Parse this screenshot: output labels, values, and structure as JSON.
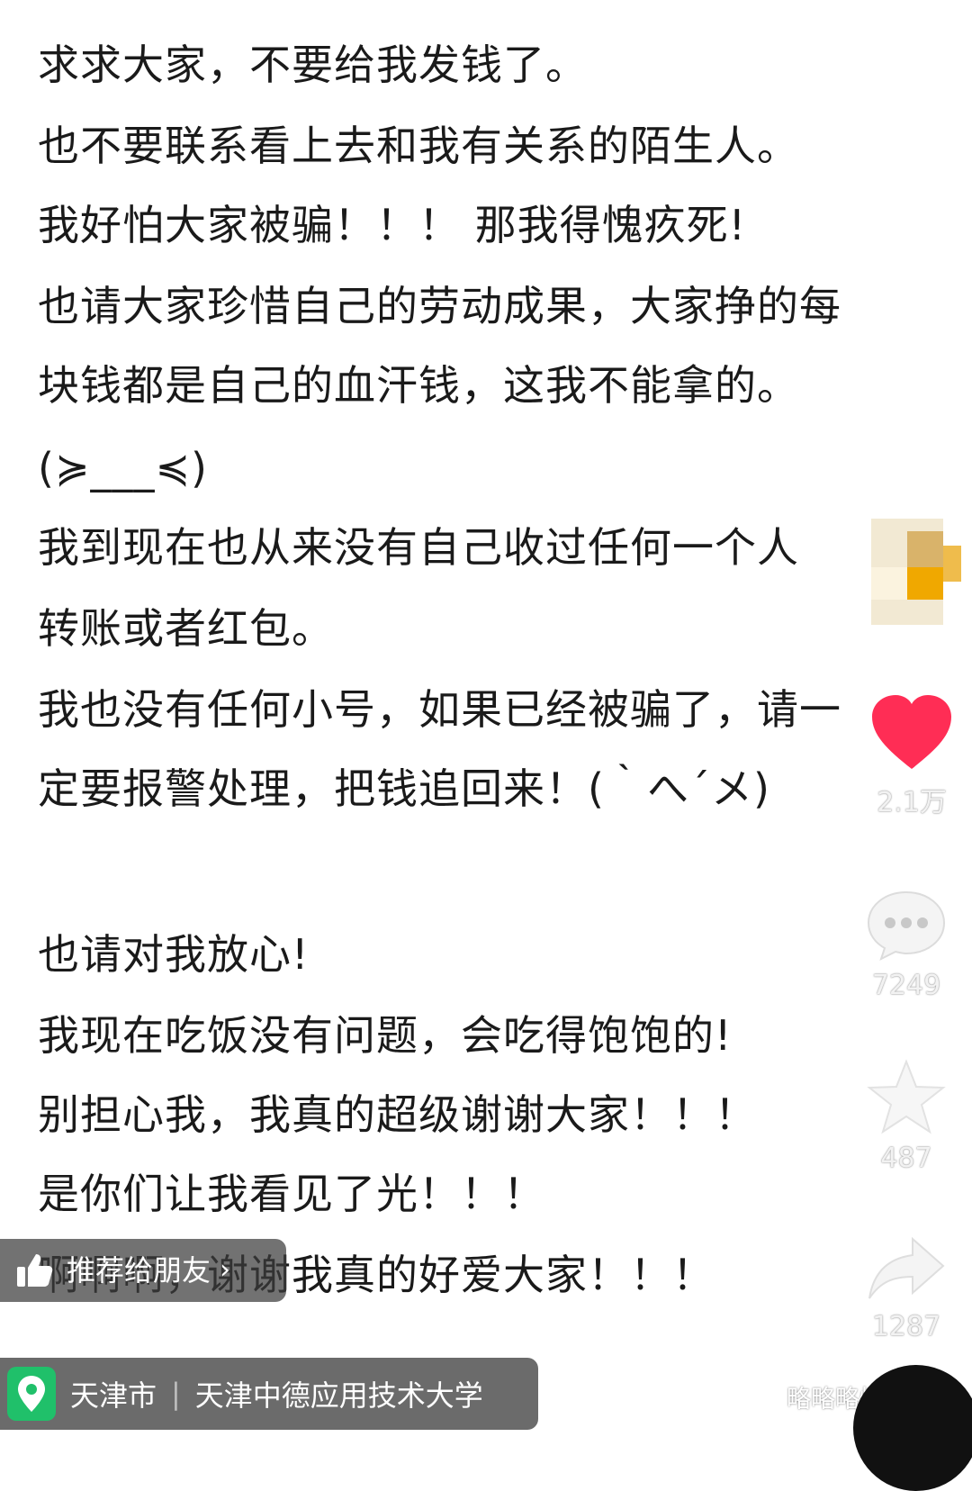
{
  "post": {
    "lines": [
      "求求大家，不要给我发钱了。",
      "也不要联系看上去和我有关系的陌生人。",
      "我好怕大家被骗！！！ 那我得愧疚死!",
      "也请大家珍惜自己的劳动成果，大家挣的每",
      "块钱都是自己的血汗钱，这我不能拿的。",
      "(≽___≼)",
      "我到现在也从来没有自己收过任何一个人",
      "转账或者红包。",
      "我也没有任何小号，如果已经被骗了，请一",
      "定要报警处理，把钱追回来！(｀へ´メ)",
      "也请对我放心!",
      "我现在吃饭没有问题，会吃得饱饱的!",
      "别担心我，我真的超级谢谢大家！！！",
      "是你们让我看见了光！！！",
      "啊啊啊，谢谢我真的好爱大家！！！"
    ]
  },
  "rail": {
    "like_count": "2.1万",
    "comment_count": "7249",
    "favorite_count": "487",
    "share_count": "1287"
  },
  "overlays": {
    "recommend_label": "推荐给朋友",
    "location_city": "天津市",
    "location_school": "天津中德应用技术大学",
    "watermark_text": "略略略懂一二"
  },
  "colors": {
    "like_heart": "#ff2d55",
    "location_pin": "#20c06a",
    "text": "#1a1a1a"
  }
}
